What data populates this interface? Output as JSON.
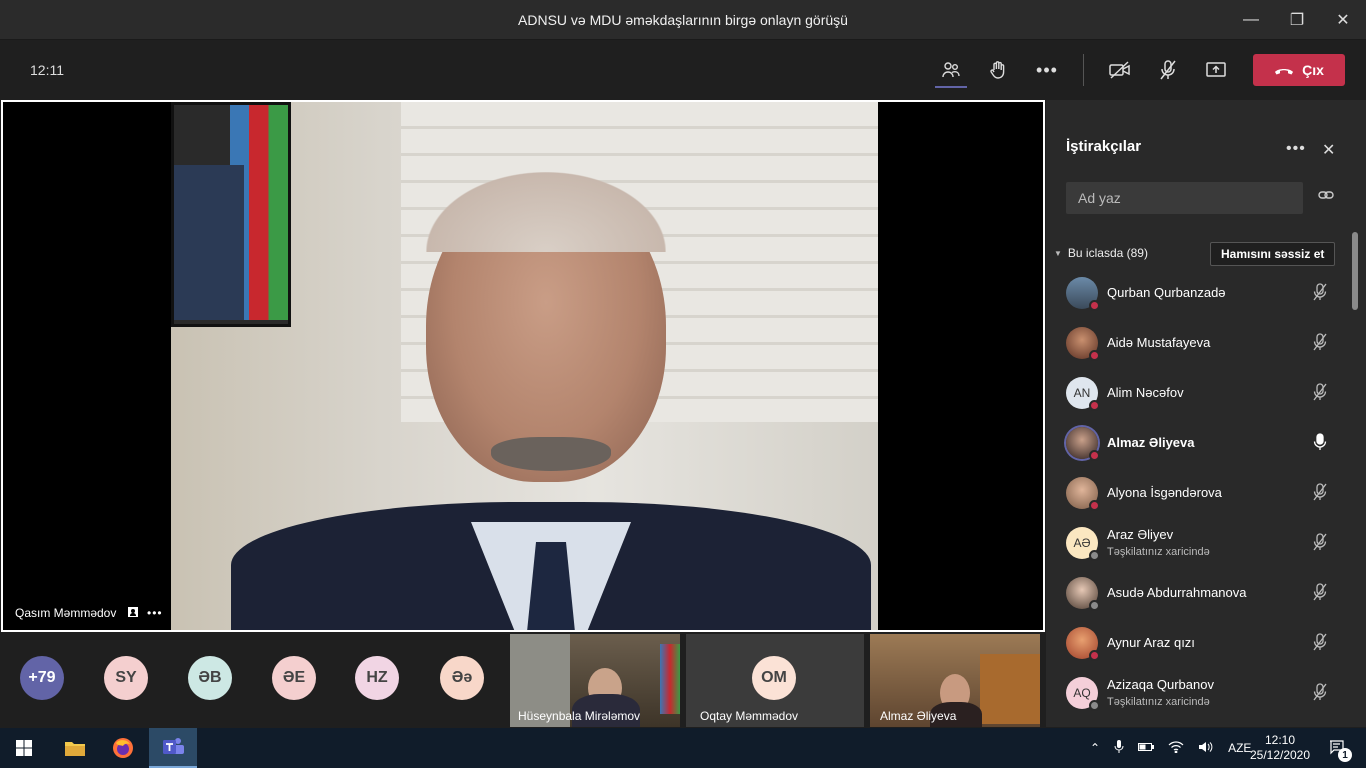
{
  "window": {
    "title": "ADNSU və MDU əməkdaşlarının birgə onlayn görüşü"
  },
  "toolbar": {
    "timer": "12:11",
    "leave_label": "Çıx"
  },
  "stage": {
    "speaker_name": "Qasım Məmmədov"
  },
  "strip": {
    "bubbles": [
      {
        "label": "+79",
        "color": "#6264a7"
      },
      {
        "label": "SY",
        "color": "#f4cfcf"
      },
      {
        "label": "ƏB",
        "color": "#cde8e4"
      },
      {
        "label": "ƏE",
        "color": "#f4cfcf"
      },
      {
        "label": "HZ",
        "color": "#f1d5e4"
      },
      {
        "label": "Əə",
        "color": "#f8d7c9"
      }
    ],
    "tiles": [
      {
        "name": "Hüseynbala Mirələmov"
      },
      {
        "name": "Oqtay Məmmədov",
        "initials": "OM"
      },
      {
        "name": "Almaz Əliyeva"
      }
    ]
  },
  "panel": {
    "title": "İştirakçılar",
    "search_placeholder": "Ad yaz",
    "section_label": "Bu iclasda (89)",
    "mute_all_label": "Hamısını səssiz et",
    "participants": [
      {
        "name": "Qurban Qurbanzadə",
        "avatar": "photo",
        "status": "#c4314b",
        "mic": "muted",
        "bold": false
      },
      {
        "name": "Aidə Mustafayeva",
        "avatar": "photo",
        "status": "#c4314b",
        "mic": "muted",
        "bold": false
      },
      {
        "name": "Alim Nəcəfov",
        "initials": "AN",
        "avatar_color": "#dfe6ee",
        "status": "#c4314b",
        "mic": "muted",
        "bold": false
      },
      {
        "name": "Almaz Əliyeva",
        "avatar": "photo",
        "status": "#c4314b",
        "mic": "on",
        "bold": true
      },
      {
        "name": "Alyona İsgəndərova",
        "avatar": "photo",
        "status": "#c4314b",
        "mic": "muted",
        "bold": false
      },
      {
        "name": "Araz Əliyev",
        "initials": "AƏ",
        "avatar_color": "#fbe7c1",
        "status": "#8a8a8a",
        "sub": "Təşkilatınız xaricində",
        "mic": "muted",
        "bold": false
      },
      {
        "name": "Asudə Abdurrahmanova",
        "avatar": "photo",
        "status": "#8a8a8a",
        "mic": "muted",
        "bold": false
      },
      {
        "name": "Aynur Araz qızı",
        "avatar": "photo",
        "status": "#c4314b",
        "mic": "muted",
        "bold": false
      },
      {
        "name": "Azizaqa Qurbanov",
        "initials": "AQ",
        "avatar_color": "#f4cfd9",
        "status": "#8a8a8a",
        "sub": "Təşkilatınız xaricində",
        "mic": "muted",
        "bold": false
      }
    ]
  },
  "taskbar": {
    "language": "AZE",
    "time": "12:10",
    "date": "25/12/2020",
    "notification_count": "1"
  }
}
